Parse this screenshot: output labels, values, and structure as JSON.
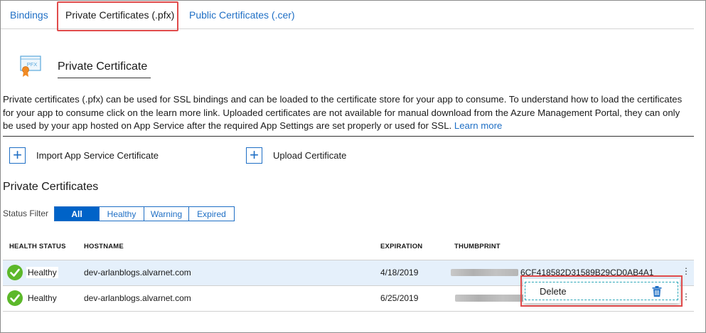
{
  "tabs": [
    {
      "label": "Bindings"
    },
    {
      "label": "Private Certificates (.pfx)"
    },
    {
      "label": "Public Certificates (.cer)"
    }
  ],
  "header": {
    "icon_text": "PFX",
    "title": "Private Certificate"
  },
  "description": {
    "text": "Private certificates (.pfx) can be used for SSL bindings and can be loaded to the certificate store for your app to consume. To understand how to load the certificates for your app to consume click on the learn more link. Uploaded certificates are not available for manual download from the Azure Management Portal, they can only be used by your app hosted on App Service after the required App Settings are set properly or used for SSL.",
    "link": "Learn more"
  },
  "actions": {
    "import_label": "Import App Service Certificate",
    "upload_label": "Upload Certificate"
  },
  "list": {
    "title": "Private Certificates",
    "filter_label": "Status Filter",
    "filters": [
      "All",
      "Healthy",
      "Warning",
      "Expired"
    ],
    "active_filter": "All"
  },
  "table": {
    "headers": {
      "health": "HEALTH STATUS",
      "hostname": "HOSTNAME",
      "expiration": "EXPIRATION",
      "thumbprint": "THUMBPRINT"
    },
    "rows": [
      {
        "health": "Healthy",
        "hostname": "dev-arlanblogs.alvarnet.com",
        "expiration": "4/18/2019",
        "thumbprint": "6CF418582D31589B29CD0AB4A1"
      },
      {
        "health": "Healthy",
        "hostname": "dev-arlanblogs.alvarnet.com",
        "expiration": "6/25/2019",
        "thumbprint": ""
      }
    ]
  },
  "context_menu": {
    "delete_label": "Delete"
  },
  "colors": {
    "accent": "#1f6fc5",
    "active_filter_bg": "#0063c8",
    "selected_row": "#e5f0fb",
    "highlight": "#e04b4b",
    "healthy": "#5cb82a"
  }
}
